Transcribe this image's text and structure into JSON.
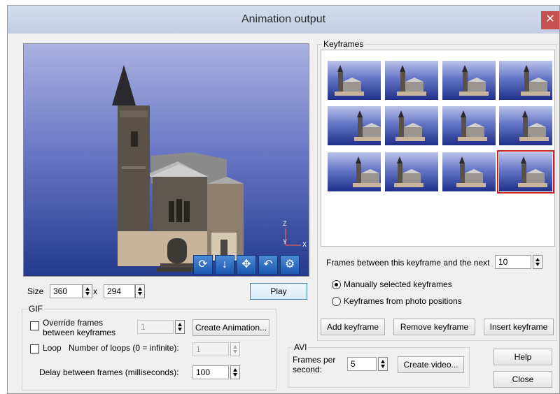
{
  "window": {
    "title": "Animation output",
    "close_label": "✕"
  },
  "viewport": {
    "axis_z": "Z",
    "axis_y": "Y",
    "axis_x": "X",
    "tools": [
      "rotate-icon",
      "move-down-icon",
      "pan-icon",
      "undo-icon",
      "settings-icon"
    ]
  },
  "size": {
    "label": "Size",
    "width": "360",
    "separator": "x",
    "height": "294"
  },
  "play_label": "Play",
  "gif": {
    "title": "GIF",
    "override_line1": "Override frames",
    "override_line2": "between keyframes",
    "override_value": "1",
    "create_animation_label": "Create Animation...",
    "loop_label": "Loop",
    "loops_label": "Number of loops (0 = infinite):",
    "loops_value": "1",
    "delay_label": "Delay between frames (milliseconds):",
    "delay_value": "100"
  },
  "keyframes": {
    "title": "Keyframes",
    "selected_index": 11,
    "count": 12,
    "frames_between_label": "Frames between this keyframe and the next",
    "frames_between_value": "10",
    "radio_manual": "Manually selected keyframes",
    "radio_photo": "Keyframes from photo positions",
    "selected_mode": "manual",
    "add_label": "Add keyframe",
    "remove_label": "Remove keyframe",
    "insert_label": "Insert keyframe"
  },
  "avi": {
    "title": "AVI",
    "fps_line1": "Frames per",
    "fps_line2": "second:",
    "fps_value": "5",
    "create_video_label": "Create video..."
  },
  "help_label": "Help",
  "close_label": "Close",
  "colors": {
    "selected_outline": "#d02020",
    "sky_top": "#a9b2e0",
    "sky_bottom": "#243a8c"
  }
}
